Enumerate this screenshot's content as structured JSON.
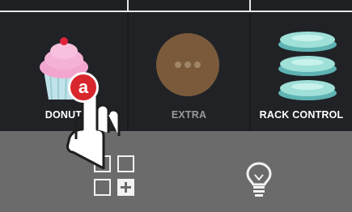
{
  "tiles": [
    {
      "label": "DONUT",
      "icon": "cupcake-icon",
      "label_color": "#ffffff"
    },
    {
      "label": "EXTRA",
      "icon": "more-icon",
      "label_color": "#9a9a9a"
    },
    {
      "label": "RACK CONTROL",
      "icon": "rack-control-icon",
      "label_color": "#ffffff"
    }
  ],
  "overlay": {
    "badge_text": "a",
    "badge_color": "#d8262d",
    "icon": "tap-hand-icon"
  },
  "bottom": {
    "layout_button": {
      "icon": "add-tile-grid-icon"
    },
    "light_button": {
      "icon": "lightbulb-icon"
    }
  }
}
